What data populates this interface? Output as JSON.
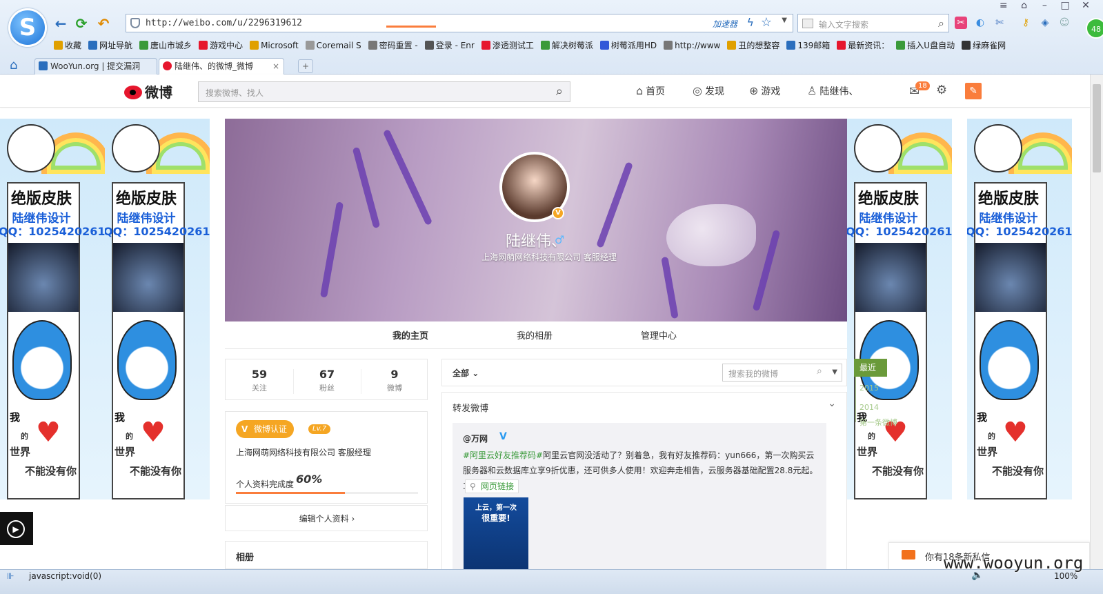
{
  "browser": {
    "url": "http://weibo.com/u/2296319612",
    "accelerator": "加速器",
    "search_placeholder": "输入文字搜索",
    "badge": "48",
    "bookmarks": [
      "收藏",
      "网址导航",
      "唐山市城乡",
      "游戏中心",
      "Microsoft",
      "Coremail S",
      "密码重置 -",
      "登录 - Enr",
      "渗透测试工",
      "解决树莓派",
      "树莓派用HD",
      "http://www",
      "丑的想整容",
      "139邮箱",
      "最新资讯：",
      "插入U盘自动",
      "绿麻雀网"
    ],
    "tabs": [
      "WooYun.org | 提交漏洞",
      "陆继伟、的微博_微博"
    ],
    "status_text": "javascript:void(0)",
    "zoom": "100%",
    "watermark": "www.wooyun.org"
  },
  "weibo_nav": {
    "logo": "微博",
    "search_placeholder": "搜索微博、找人",
    "home": "首页",
    "discover": "发现",
    "games": "游戏",
    "user": "陆继伟、",
    "mail_count": "18"
  },
  "skin": {
    "title": "绝版皮肤",
    "designer": "陆继伟设计",
    "qq": "QQ：1025420261",
    "wo": "我",
    "de": "的",
    "shijie": "世界",
    "bunengmeiyouni": "不能没有你"
  },
  "profile": {
    "name": "陆继伟、",
    "company": "上海网萌网络科技有限公司 客服经理",
    "verified_mark": "V"
  },
  "profile_tabs": [
    "我的主页",
    "我的相册",
    "管理中心"
  ],
  "stats": [
    {
      "num": "59",
      "label": "关注"
    },
    {
      "num": "67",
      "label": "粉丝"
    },
    {
      "num": "9",
      "label": "微博"
    }
  ],
  "info": {
    "cert": "微博认证",
    "level": "Lv.7",
    "company": "上海网萌网络科技有限公司 客服经理",
    "completion_label": "个人资料完成度",
    "completion_value": "60%",
    "completion_fraction": 0.6,
    "edit": "编辑个人资料",
    "album": "相册"
  },
  "feed": {
    "filter": "全部",
    "search_placeholder": "搜索我的微博",
    "post_title": "转发微博",
    "quote_user": "@万网",
    "hashtag": "#阿里云好友推荐码#",
    "text": "阿里云官网没活动了？别着急，我有好友推荐码：yun666，第一次购买云服务器和云数据库立享9折优惠，还可供多人使用！欢迎奔走相告，云服务器基础配置28.8元起。立即查看：",
    "link": "网页链接",
    "img_line1": "上云，第一次",
    "img_line2": "很重要!"
  },
  "timeline": [
    "最近",
    "2015",
    "2014",
    "第一条微博"
  ],
  "messages": "你有18条新私信"
}
